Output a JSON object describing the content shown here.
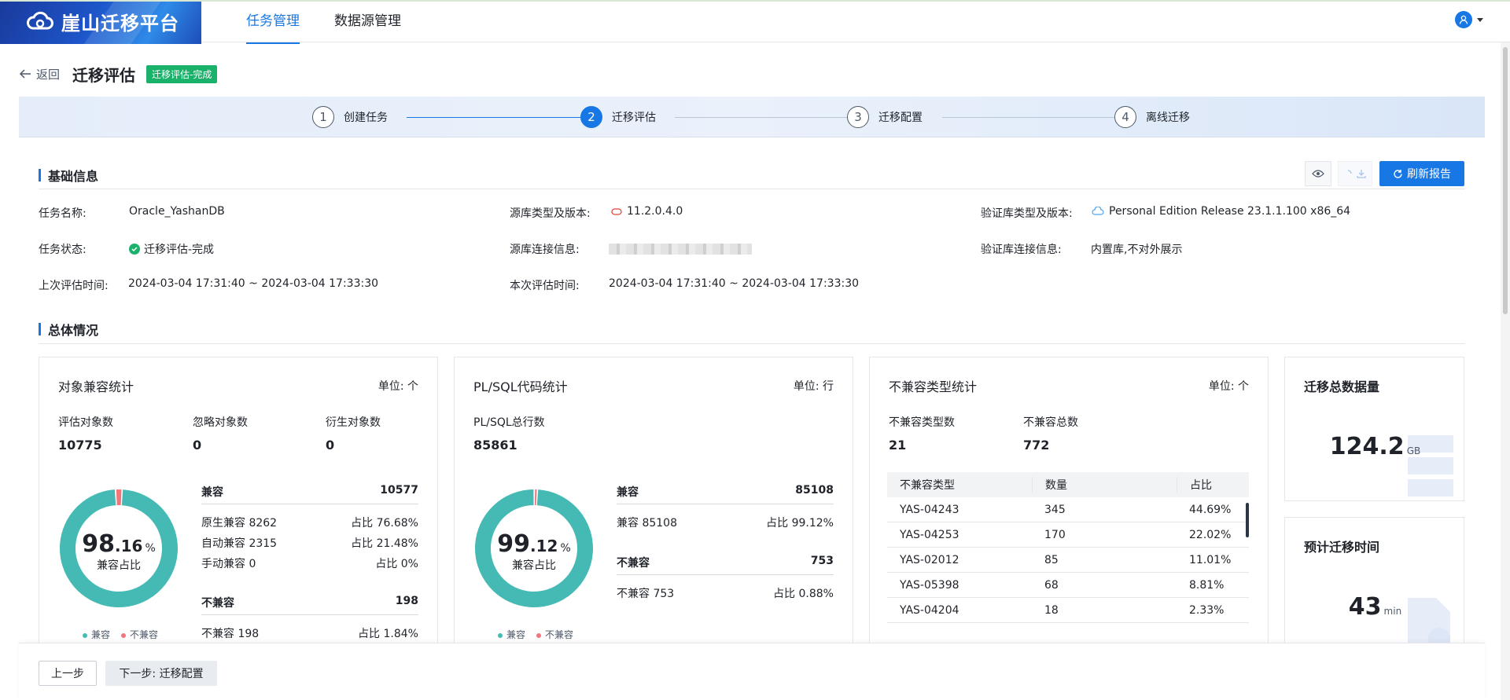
{
  "app": {
    "title": "崖山迁移平台"
  },
  "nav": {
    "tabs": [
      {
        "label": "任务管理"
      },
      {
        "label": "数据源管理"
      }
    ]
  },
  "header": {
    "back_label": "返回",
    "page_title": "迁移评估",
    "status_badge": "迁移评估-完成"
  },
  "steps": [
    {
      "num": "1",
      "label": "创建任务"
    },
    {
      "num": "2",
      "label": "迁移评估"
    },
    {
      "num": "3",
      "label": "迁移配置"
    },
    {
      "num": "4",
      "label": "离线迁移"
    }
  ],
  "basic": {
    "title": "基础信息",
    "refresh_label": "刷新报告",
    "task_name_label": "任务名称:",
    "task_name": "Oracle_YashanDB",
    "task_status_label": "任务状态:",
    "task_status": "迁移评估-完成",
    "last_eval_label": "上次评估时间:",
    "last_eval": "2024-03-04 17:31:40 ~ 2024-03-04 17:33:30",
    "source_type_label": "源库类型及版本:",
    "source_type": "11.2.0.4.0",
    "source_conn_label": "源库连接信息:",
    "this_eval_label": "本次评估时间:",
    "this_eval": "2024-03-04 17:31:40 ~ 2024-03-04 17:33:30",
    "verify_type_label": "验证库类型及版本:",
    "verify_type": "Personal Edition Release 23.1.1.100 x86_64",
    "verify_conn_label": "验证库连接信息:",
    "verify_conn": "内置库,不对外展示"
  },
  "overview": {
    "title": "总体情况"
  },
  "obj_card": {
    "title": "对象兼容统计",
    "unit": "单位: 个",
    "m1_label": "评估对象数",
    "m1_val": "10775",
    "m2_label": "忽略对象数",
    "m2_val": "0",
    "m3_label": "衍生对象数",
    "m3_val": "0",
    "pct_int": "98",
    "pct_dec": ".16",
    "pct_sym": "%",
    "pct_caption": "兼容占比",
    "compat_fraction": 0.9816,
    "compat_label": "兼容",
    "compat_total": "10577",
    "r1_label": "原生兼容 8262",
    "r1_pct": "占比 76.68%",
    "r2_label": "自动兼容 2315",
    "r2_pct": "占比 21.48%",
    "r3_label": "手动兼容 0",
    "r3_pct": "占比 0%",
    "incompat_label": "不兼容",
    "incompat_total": "198",
    "r4_label": "不兼容 198",
    "r4_pct": "占比 1.84%",
    "legend_compat": "兼容",
    "legend_incompat": "不兼容"
  },
  "plsql_card": {
    "title": "PL/SQL代码统计",
    "unit": "单位: 行",
    "m1_label": "PL/SQL总行数",
    "m1_val": "85861",
    "pct_int": "99",
    "pct_dec": ".12",
    "pct_sym": "%",
    "pct_caption": "兼容占比",
    "compat_fraction": 0.9912,
    "compat_label": "兼容",
    "compat_total": "85108",
    "r1_label": "兼容 85108",
    "r1_pct": "占比 99.12%",
    "incompat_label": "不兼容",
    "incompat_total": "753",
    "r2_label": "不兼容 753",
    "r2_pct": "占比 0.88%",
    "legend_compat": "兼容",
    "legend_incompat": "不兼容"
  },
  "incompat_card": {
    "title": "不兼容类型统计",
    "unit": "单位: 个",
    "m1_label": "不兼容类型数",
    "m1_val": "21",
    "m2_label": "不兼容总数",
    "m2_val": "772",
    "columns": [
      "不兼容类型",
      "数量",
      "占比"
    ],
    "rows": [
      [
        "YAS-04243",
        "345",
        "44.69%"
      ],
      [
        "YAS-04253",
        "170",
        "22.02%"
      ],
      [
        "YAS-02012",
        "85",
        "11.01%"
      ],
      [
        "YAS-05398",
        "68",
        "8.81%"
      ],
      [
        "YAS-04204",
        "18",
        "2.33%"
      ]
    ]
  },
  "total_card": {
    "title": "迁移总数据量",
    "value": "124.2",
    "unit": "GB"
  },
  "time_card": {
    "title": "预计迁移时间",
    "value": "43",
    "unit": "min"
  },
  "footer": {
    "prev_label": "上一步",
    "next_label": "下一步: 迁移配置"
  },
  "colors": {
    "primary": "#1677e5",
    "teal": "#45bab5",
    "red": "#f0767b",
    "success": "#1ab26b"
  }
}
